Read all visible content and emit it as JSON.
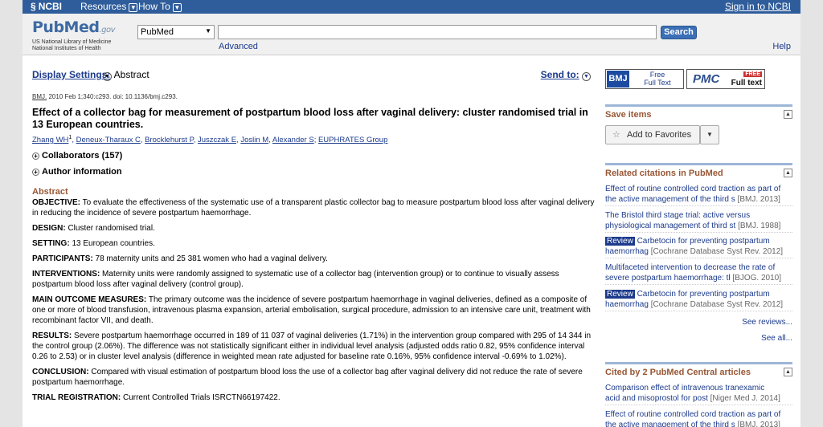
{
  "ncbi": {
    "logo": "NCBI",
    "menus": [
      {
        "label": "Resources"
      },
      {
        "label": "How To"
      }
    ],
    "signin": "Sign in to NCBI"
  },
  "header": {
    "logo_main": "PubMed",
    "logo_gov": ".gov",
    "logo_sub1": "US National Library of Medicine",
    "logo_sub2": "National Institutes of Health",
    "db_value": "PubMed",
    "search_value": "",
    "search_button": "Search",
    "advanced": "Advanced",
    "help": "Help"
  },
  "toolbar": {
    "display_settings": "Display Settings:",
    "display_value": "Abstract",
    "send_to": "Send to:"
  },
  "article": {
    "journal": "BMJ.",
    "citation": " 2010 Feb 1;340:c293. doi: 10.1136/bmj.c293.",
    "title": "Effect of a collector bag for measurement of postpartum blood loss after vaginal delivery: cluster randomised trial in 13 European countries.",
    "authors": [
      {
        "name": "Zhang WH",
        "sup": "1"
      },
      {
        "name": "Deneux-Tharaux C"
      },
      {
        "name": "Brocklehurst P"
      },
      {
        "name": "Juszczak E"
      },
      {
        "name": "Joslin M"
      },
      {
        "name": "Alexander S"
      },
      {
        "name": "EUPHRATES Group"
      }
    ],
    "collaborators": "Collaborators (157)",
    "author_info": "Author information",
    "abstract_heading": "Abstract",
    "abstract": [
      {
        "label": "OBJECTIVE:",
        "text": " To evaluate the effectiveness of the systematic use of a transparent plastic collector bag to measure postpartum blood loss after vaginal delivery in reducing the incidence of severe postpartum haemorrhage."
      },
      {
        "label": "DESIGN:",
        "text": " Cluster randomised trial."
      },
      {
        "label": "SETTING:",
        "text": " 13 European countries."
      },
      {
        "label": "PARTICIPANTS:",
        "text": " 78 maternity units and 25 381 women who had a vaginal delivery."
      },
      {
        "label": "INTERVENTIONS:",
        "text": " Maternity units were randomly assigned to systematic use of a collector bag (intervention group) or to continue to visually assess postpartum blood loss after vaginal delivery (control group)."
      },
      {
        "label": "MAIN OUTCOME MEASURES:",
        "text": " The primary outcome was the incidence of severe postpartum haemorrhage in vaginal deliveries, defined as a composite of one or more of blood transfusion, intravenous plasma expansion, arterial embolisation, surgical procedure, admission to an intensive care unit, treatment with recombinant factor VII, and death."
      },
      {
        "label": "RESULTS:",
        "text": " Severe postpartum haemorrhage occurred in 189 of 11 037 of vaginal deliveries (1.71%) in the intervention group compared with 295 of 14 344 in the control group (2.06%). The difference was not statistically significant either in individual level analysis (adjusted odds ratio 0.82, 95% confidence interval 0.26 to 2.53) or in cluster level analysis (difference in weighted mean rate adjusted for baseline rate 0.16%, 95% confidence interval -0.69% to 1.02%)."
      },
      {
        "label": "CONCLUSION:",
        "text": " Compared with visual estimation of postpartum blood loss the use of a collector bag after vaginal delivery did not reduce the rate of severe postpartum haemorrhage."
      },
      {
        "label": "TRIAL REGISTRATION:",
        "text": " Current Controlled Trials ISRCTN66197422."
      }
    ]
  },
  "sidebar": {
    "bmj_logo": "BMJ",
    "bmj_text1": "Free",
    "bmj_text2": "Full Text",
    "pmc_logo": "PMC",
    "pmc_free": "FREE",
    "pmc_text": "Full text",
    "save_items": "Save items",
    "add_favorites": "Add to Favorites",
    "related_heading": "Related citations in PubMed",
    "related": [
      {
        "review": "",
        "line1": "Effect of routine controlled cord traction as part of",
        "line2": "the active management of the third s",
        "src": "[BMJ. 2013]"
      },
      {
        "review": "",
        "line1": "The Bristol third stage trial: active versus",
        "line2": "physiological management of third st",
        "src": "[BMJ. 1988]"
      },
      {
        "review": "Review",
        "line1": " Carbetocin for preventing postpartum",
        "line2": "haemorrhag",
        "src": "[Cochrane Database Syst Rev. 2012]"
      },
      {
        "review": "",
        "line1": "Multifaceted intervention to decrease the rate of",
        "line2": "severe postpartum haemorrhage: tl",
        "src": "[BJOG. 2010]"
      },
      {
        "review": "Review",
        "line1": " Carbetocin for preventing postpartum",
        "line2": "haemorrhag",
        "src": "[Cochrane Database Syst Rev. 2012]"
      }
    ],
    "see_reviews": "See reviews...",
    "see_all": "See all...",
    "cited_heading": "Cited by 2 PubMed Central articles",
    "cited": [
      {
        "line1": "Comparison effect of intravenous tranexamic",
        "line2": "acid and misoprostol for post",
        "src": "[Niger Med J. 2014]"
      },
      {
        "line1": "Effect of routine controlled cord traction as part of",
        "line2": "the active management of the third s",
        "src": "[BMJ. 2013]"
      }
    ]
  }
}
